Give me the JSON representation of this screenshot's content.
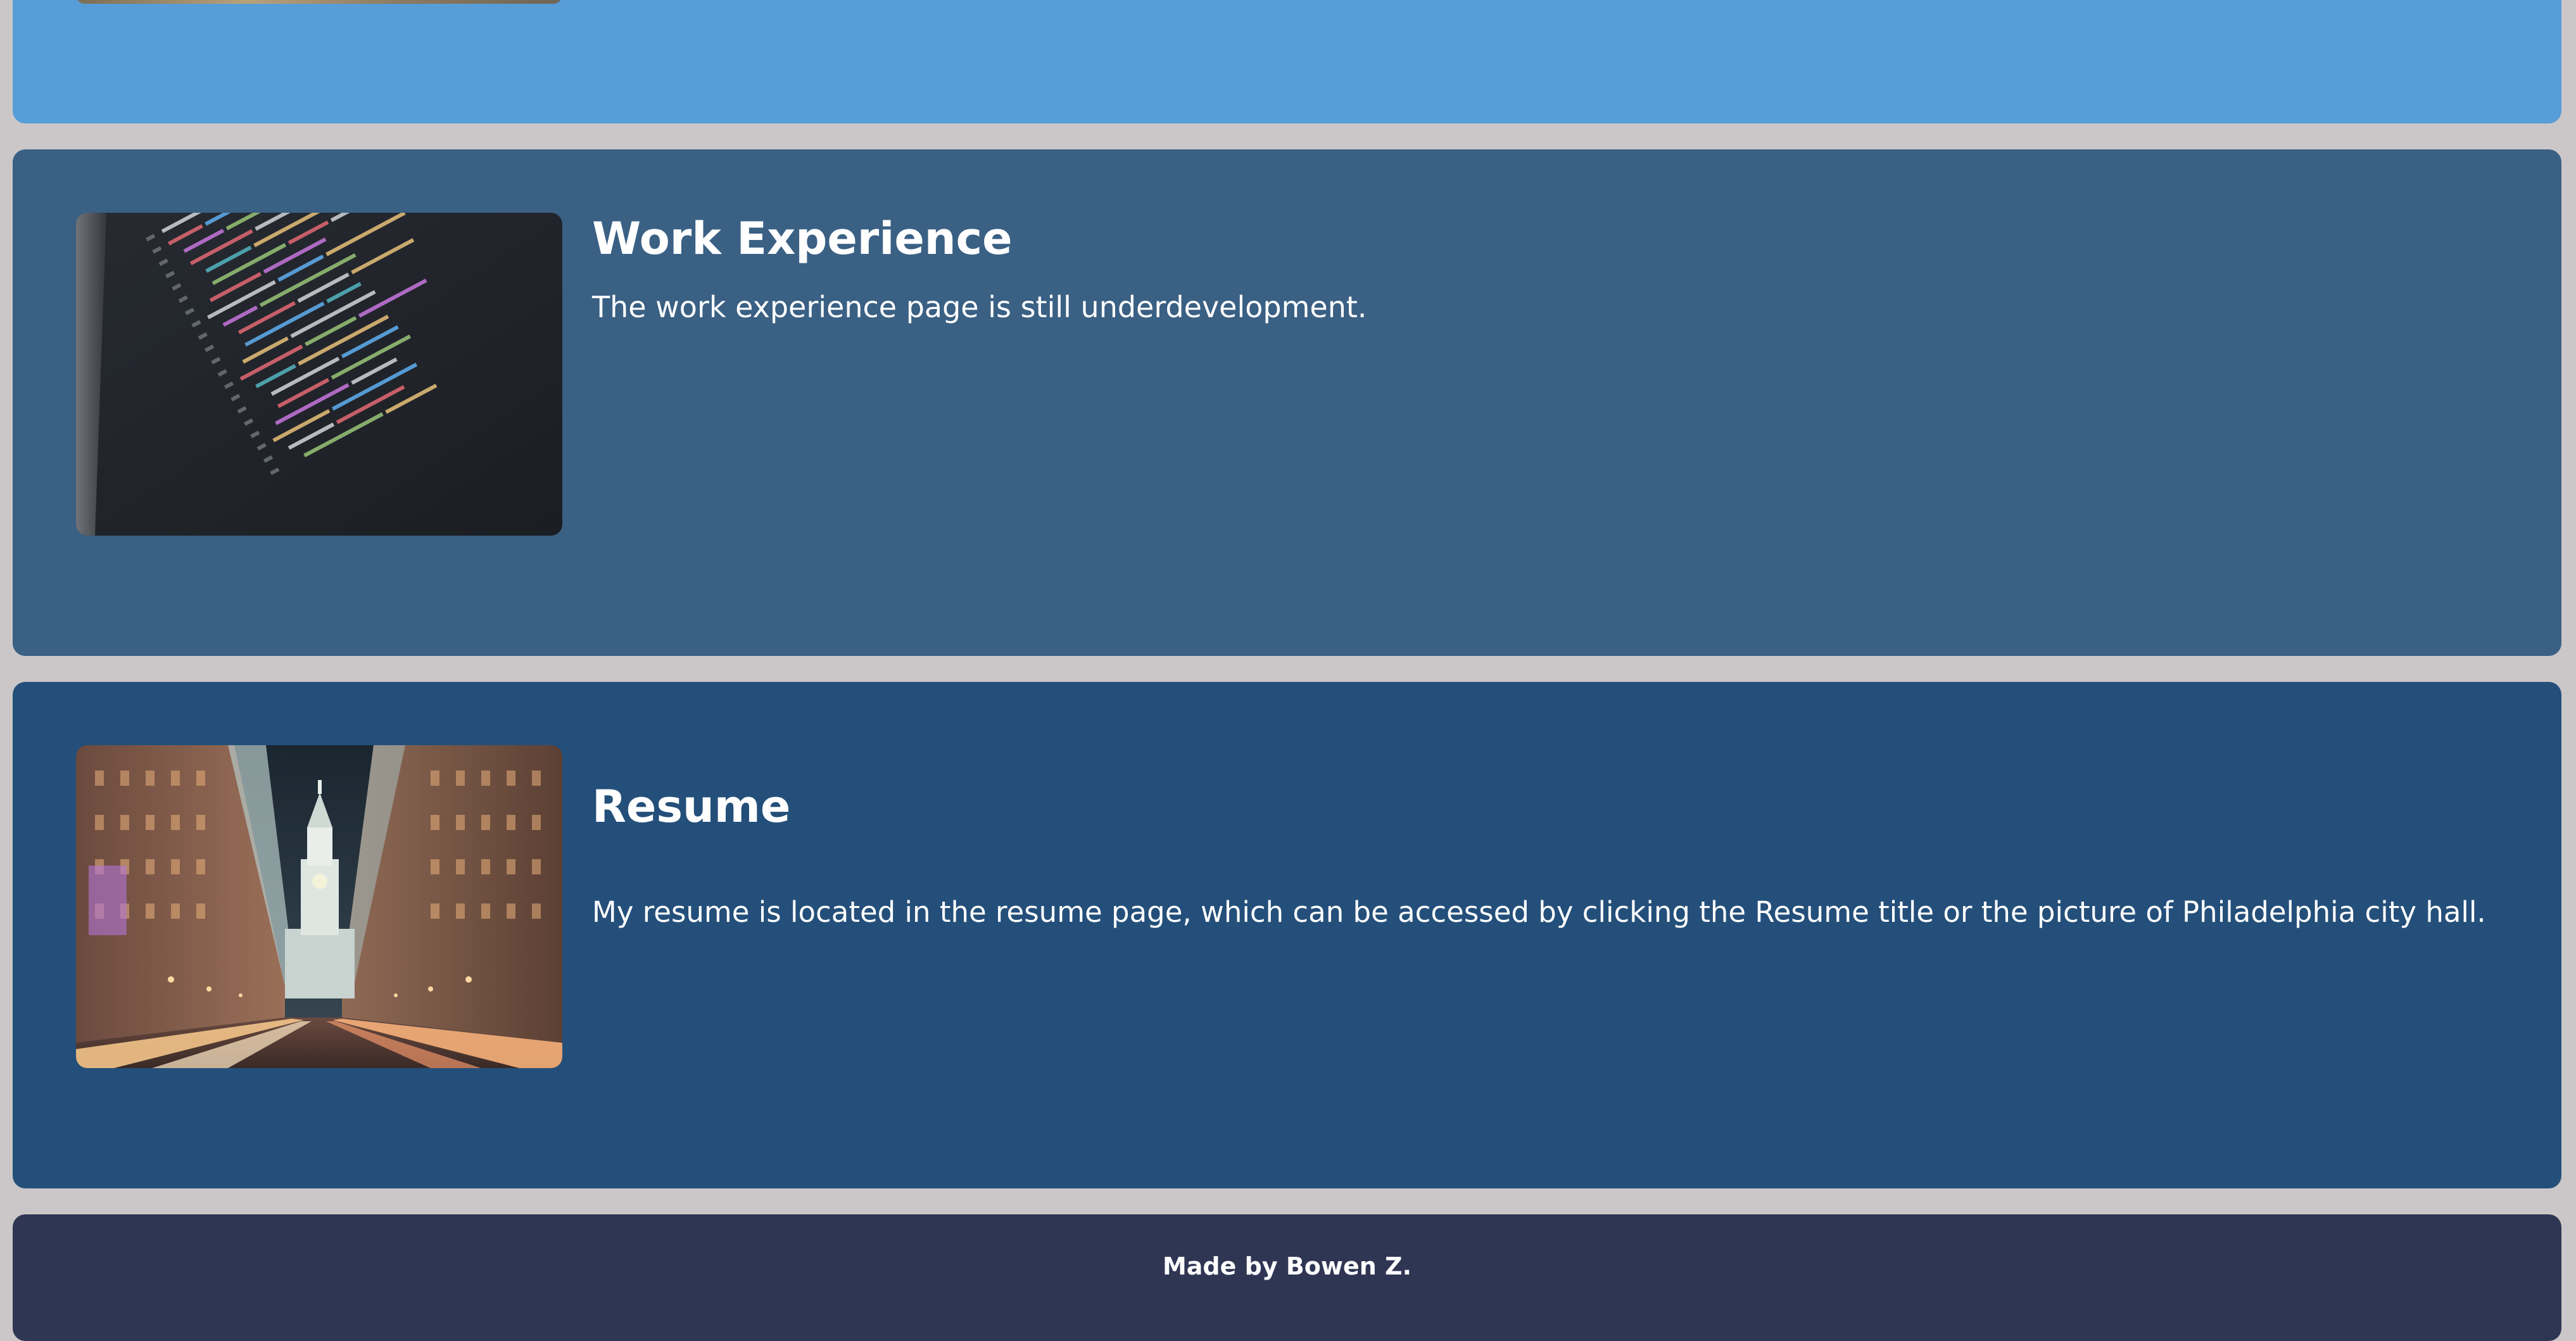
{
  "sections": {
    "work": {
      "title": "Work Experience",
      "description": "The work experience page is still underdevelopment."
    },
    "resume": {
      "title": "Resume",
      "description": "My resume is located in the resume page, which can be accessed by clicking the Resume title or the picture of Philadelphia city hall."
    }
  },
  "footer": {
    "text": "Made by Bowen Z."
  },
  "colors": {
    "page_background": "#cbc7c8",
    "top_card": "#579dd8",
    "work_card": "#3a6084",
    "resume_card": "#244f7a",
    "footer": "#2f3654",
    "text": "#ffffff"
  }
}
